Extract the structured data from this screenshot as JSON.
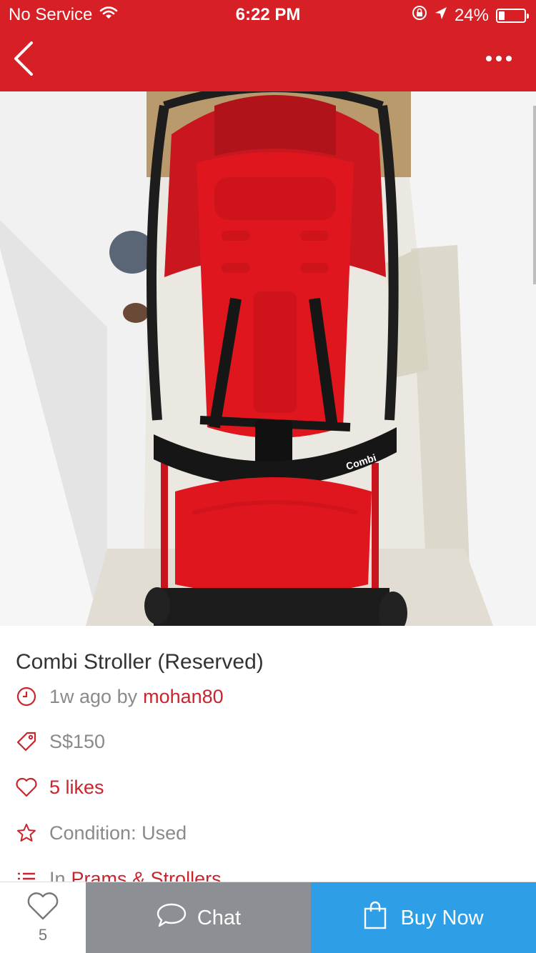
{
  "status_bar": {
    "carrier": "No Service",
    "time": "6:22 PM",
    "battery": "24%",
    "battery_level": 0.24
  },
  "nav": {
    "back_icon": "chevron-left-icon",
    "more_icon": "more-horizontal-icon"
  },
  "colors": {
    "brand": "#d71f26",
    "link_red": "#c9252c",
    "chat_gray": "#8c8f94",
    "buy_blue": "#2e9ee6"
  },
  "listing": {
    "title": "Combi Stroller (Reserved)",
    "time_ago": "1w ago by",
    "seller": "mohan80",
    "price": "S$150",
    "likes": "5 likes",
    "condition": "Condition: Used",
    "category_prefix": "In",
    "category": "Prams & Strollers",
    "photo_brand_text": "Combi"
  },
  "bottom_bar": {
    "like_count": "5",
    "chat_label": "Chat",
    "buy_label": "Buy Now"
  }
}
